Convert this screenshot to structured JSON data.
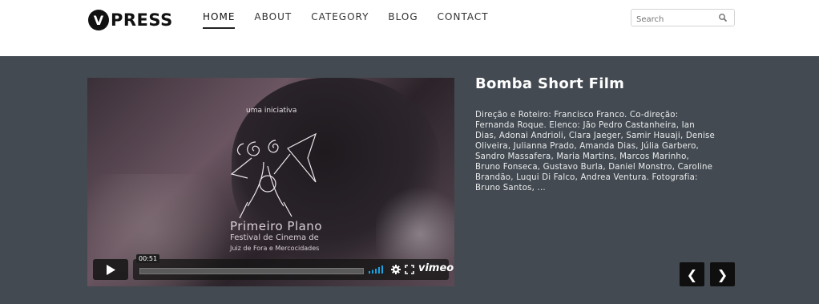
{
  "header": {
    "logo_letter": "V",
    "logo_text": "PRESS",
    "nav": [
      {
        "label": "HOME",
        "active": true
      },
      {
        "label": "ABOUT",
        "active": false
      },
      {
        "label": "CATEGORY",
        "active": false
      },
      {
        "label": "BLOG",
        "active": false
      },
      {
        "label": "CONTACT",
        "active": false
      }
    ],
    "search": {
      "placeholder": "Search",
      "icon": "search-icon"
    }
  },
  "featured": {
    "video": {
      "overlay_small": "uma iniciativa",
      "overlay_title": "Primeiro Plano",
      "overlay_subtitle": "Festival de Cinema de",
      "overlay_subtitle2": "Juiz de Fora e Mercocidades",
      "timecode": "00:51",
      "brand": "vimeo",
      "icons": [
        "play-icon",
        "volume-icon",
        "settings-icon",
        "fullscreen-icon"
      ]
    },
    "title": "Bomba Short Film",
    "excerpt": "Direção e Roteiro: Francisco Franco. Co-direção: Fernanda Roque. Elenco: Jão Pedro Castanheira, Ian Dias, Adonai Andrioli, Clara Jaeger, Samir Hauaji, Denise Oliveira, Julianna Prado, Amanda Dias, Júlia Garbero, Sandro Massafera, Maria Martins, Marcos Marinho, Bruno Fonseca, Gustavo Burla, Daniel Monstro, Caroline Brandão, Luqui Di Falco, Andrea Ventura. Fotografia: Bruno Santos, ...",
    "prev_label": "❮",
    "next_label": "❯"
  },
  "colors": {
    "hero_bg": "#434a51",
    "text": "#ffffff",
    "button_bg": "#0f0f0f"
  }
}
